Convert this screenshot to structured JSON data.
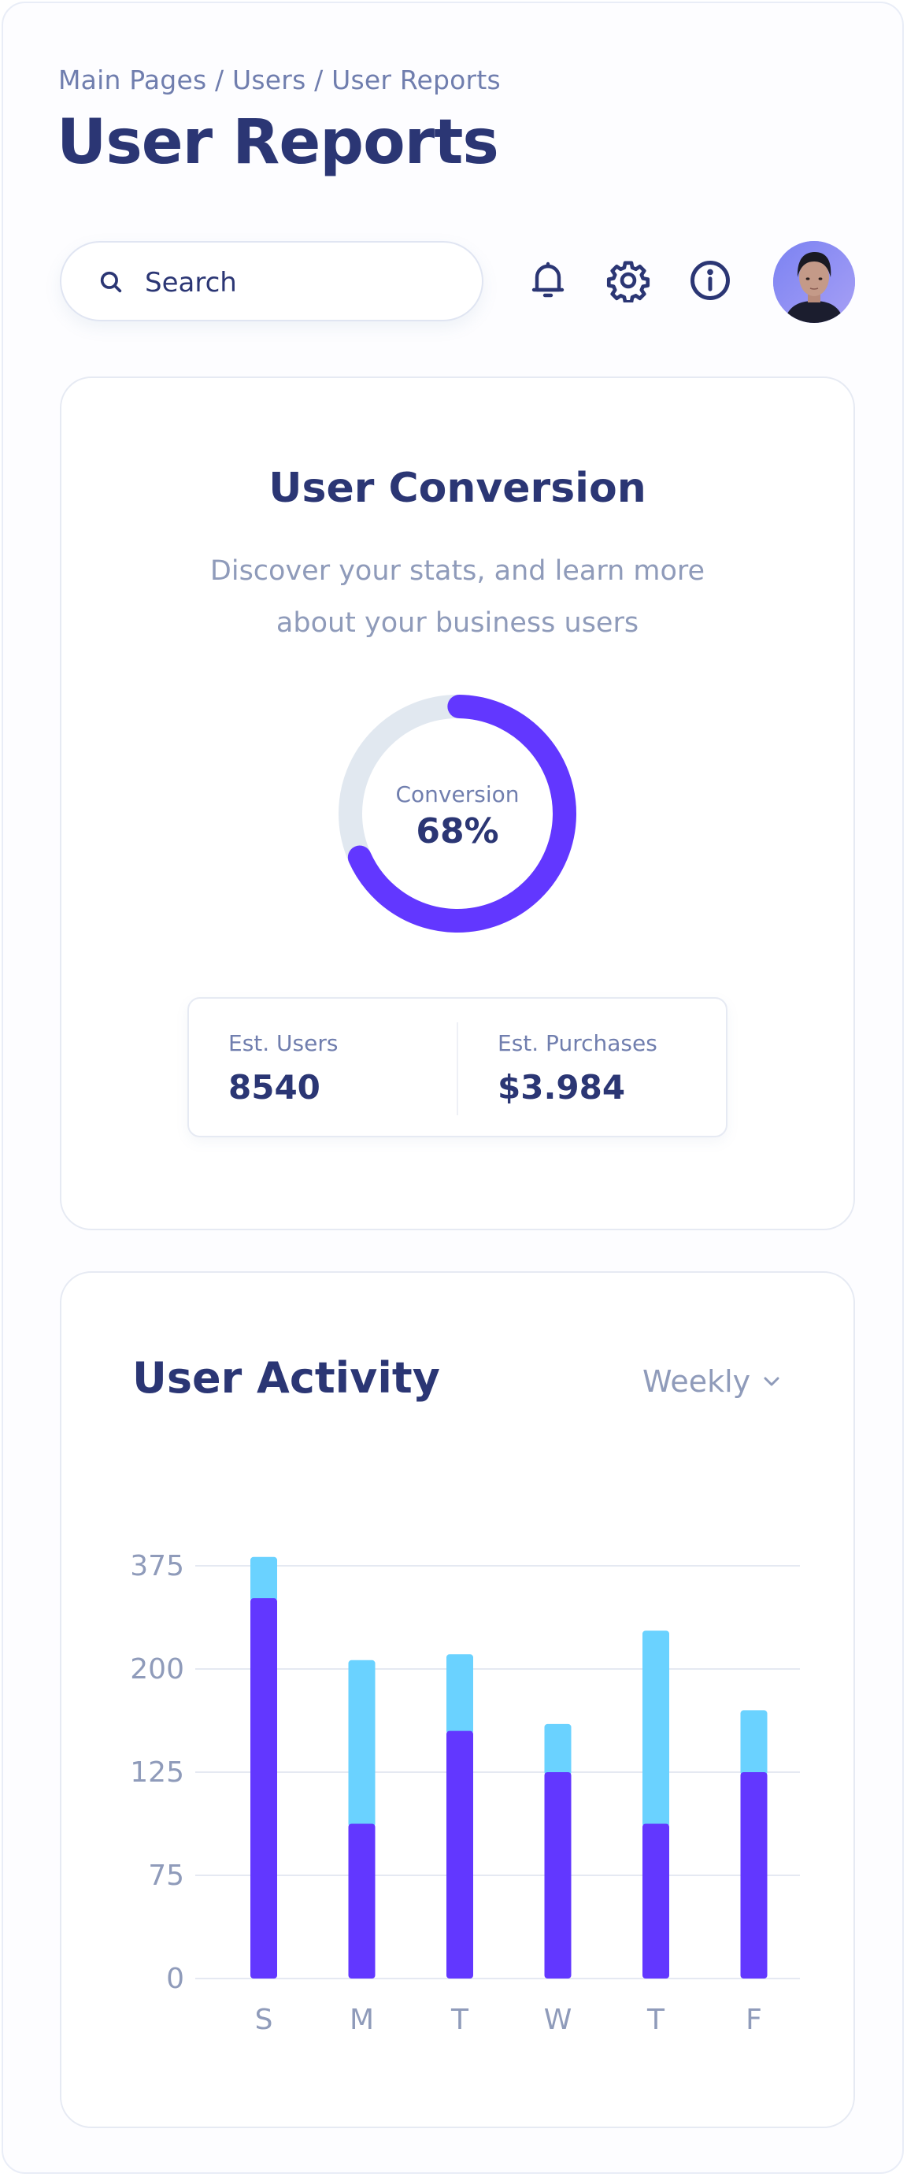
{
  "breadcrumb": "Main Pages / Users / User Reports",
  "title": "User Reports",
  "search": {
    "placeholder": "Search"
  },
  "icons": {
    "search": "search-icon",
    "notifications": "bell-icon",
    "settings": "gear-icon",
    "info": "info-icon"
  },
  "conversion_card": {
    "title": "User Conversion",
    "subtitle": "Discover your stats, and learn more about your business users",
    "donut_label": "Conversion",
    "donut_value": "68%",
    "donut_fraction": 0.68,
    "stats": [
      {
        "label": "Est. Users",
        "value": "8540"
      },
      {
        "label": "Est. Purchases",
        "value": "$3.984"
      }
    ]
  },
  "activity_card": {
    "title": "User Activity",
    "period": "Weekly"
  },
  "colors": {
    "primary": "#6237ff",
    "secondary": "#6ad2ff",
    "text_dark": "#2b3674",
    "text_muted": "#8f9bba",
    "track": "#e1e8f0"
  },
  "chart_data": {
    "type": "bar",
    "stacked": true,
    "categories": [
      "S",
      "M",
      "T",
      "W",
      "T",
      "F"
    ],
    "y_tick_labels": [
      "0",
      "75",
      "125",
      "200",
      "375"
    ],
    "series": [
      {
        "values": [
          320,
          100,
          155,
          125,
          100,
          125
        ]
      },
      {
        "values": [
          70,
          115,
          70,
          35,
          165,
          45
        ]
      }
    ],
    "grid": true
  }
}
